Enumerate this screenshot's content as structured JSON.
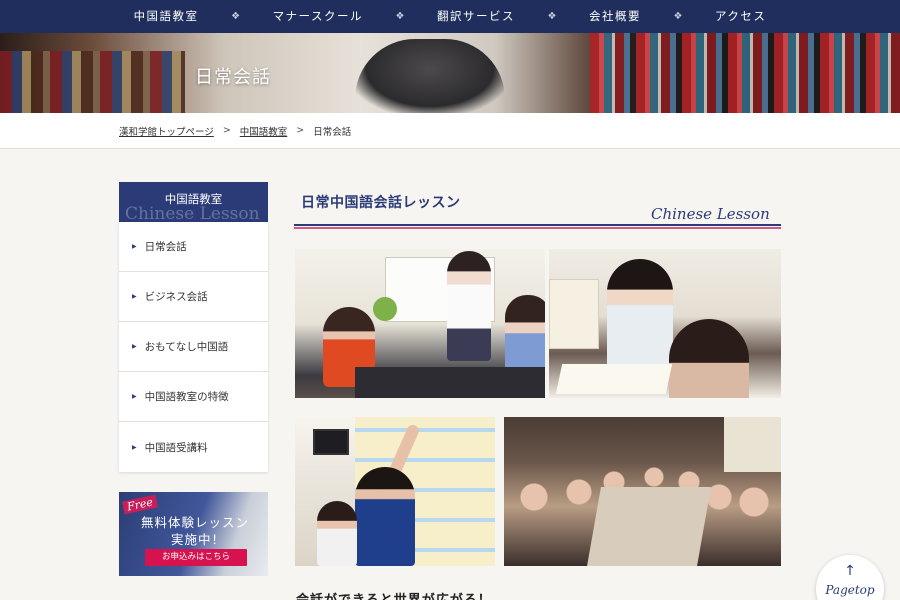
{
  "nav": {
    "items": [
      "中国語教室",
      "マナースクール",
      "翻訳サービス",
      "会社概要",
      "アクセス"
    ],
    "separator_icon": "diamond-ornament-icon"
  },
  "hero": {
    "title": "日常会話"
  },
  "breadcrumb": {
    "home": "漢和学館トップページ",
    "parent": "中国語教室",
    "current": "日常会話",
    "sep": ">"
  },
  "sidebar": {
    "heading": "中国語教室",
    "heading_ghost": "Chinese Lesson",
    "items": [
      "日常会話",
      "ビジネス会話",
      "おもてなし中国語",
      "中国語教室の特徴",
      "中国語受講料"
    ]
  },
  "free_banner": {
    "badge": "Free",
    "line1": "無料体験レッスン",
    "line2": "実施中！",
    "button": "お申込みはこちら"
  },
  "main": {
    "title": "日常中国語会話レッスン",
    "subtitle": "Chinese Lesson",
    "bottom_text": "会話ができると世界が広がる！"
  },
  "pagetop": {
    "label": "Pagetop",
    "icon": "arrow-up-icon"
  },
  "colors": {
    "navy": "#1f2e5c",
    "accent_navy": "#2a3b78",
    "pink": "#d45882",
    "cta": "#d7134f"
  }
}
